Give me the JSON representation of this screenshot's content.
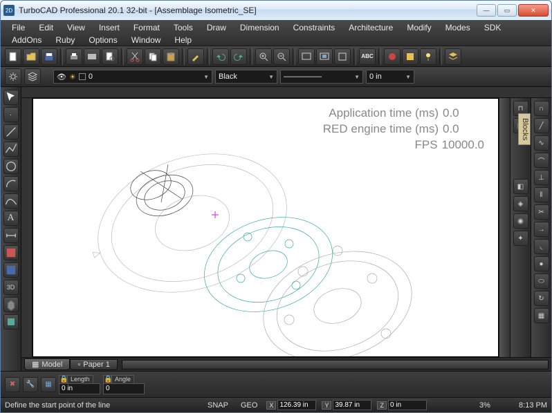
{
  "window": {
    "title": "TurboCAD Professional 20.1 32-bit - [Assemblage Isometric_SE]",
    "app_icon_text": "2D"
  },
  "menu": [
    "File",
    "Edit",
    "View",
    "Insert",
    "Format",
    "Tools",
    "Draw",
    "Dimension",
    "Constraints",
    "Architecture",
    "Modify",
    "Modes",
    "SDK",
    "AddOns",
    "Ruby",
    "Options",
    "Window",
    "Help"
  ],
  "main_toolbar_icons": [
    "new",
    "open",
    "save",
    "sep",
    "print",
    "plot",
    "print-preview",
    "sep",
    "cut",
    "copy",
    "paste",
    "sep",
    "brush",
    "sep",
    "undo",
    "redo",
    "sep",
    "zoom-in",
    "zoom-out",
    "sep",
    "zoom-window",
    "zoom-extents",
    "sep",
    "spell",
    "sep",
    "render",
    "materials",
    "lights",
    "sep",
    "layer-manager"
  ],
  "props": {
    "layer_value": "0",
    "color_value": "Black",
    "linetype_value": "—————",
    "lineweight_value": "0 in"
  },
  "left_tools": [
    "select",
    "point",
    "line",
    "polyline",
    "circle",
    "arc",
    "curve",
    "text",
    "dimension",
    "hatch",
    "block",
    "3d",
    "solid",
    "part"
  ],
  "right_tools_a": [
    "magnet",
    "layers",
    "palette",
    "props",
    "style",
    "blocks",
    "camera",
    "render",
    "light",
    "material"
  ],
  "right_tools_b": [
    "horseshoe",
    "line",
    "spline",
    "tangent",
    "perp",
    "offset",
    "trim",
    "extend",
    "fillet",
    "sphere",
    "cylinder",
    "revolve"
  ],
  "blocks_tab_label": "Blocks",
  "overlay": {
    "app_time_label": "Application time (ms)",
    "app_time_value": "0.0",
    "red_time_label": "RED engine time (ms)",
    "red_time_value": "0.0",
    "fps_label": "FPS",
    "fps_value": "10000.0"
  },
  "tabs": {
    "model": "Model",
    "paper1": "Paper 1"
  },
  "inspector": {
    "length_label": "Length",
    "length_value": "0 in",
    "angle_label": "Angle",
    "angle_value": "0"
  },
  "status": {
    "hint": "Define the start point of the line",
    "snap": "SNAP",
    "geo": "GEO",
    "x_value": "126.39 in",
    "y_value": "39.87 in",
    "z_value": "0 in",
    "zoom": "3%",
    "time": "8:13 PM"
  },
  "colors": {
    "accent": "#2a5a8a"
  }
}
